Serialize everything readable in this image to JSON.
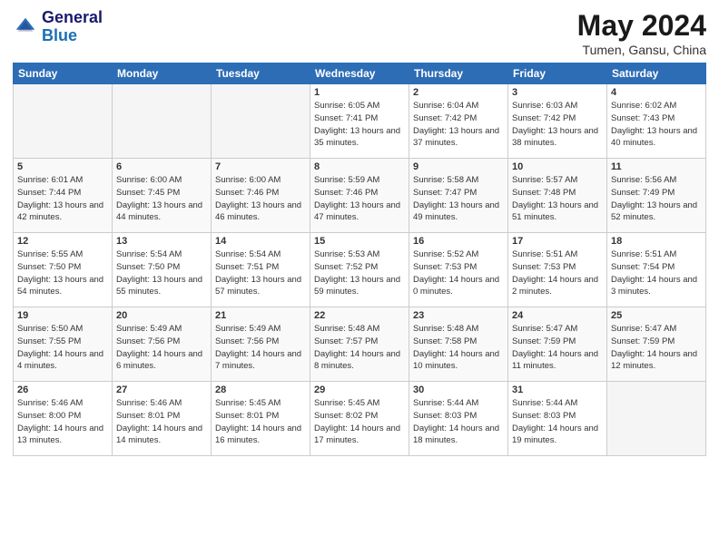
{
  "logo": {
    "line1": "General",
    "line2": "Blue"
  },
  "title": "May 2024",
  "subtitle": "Tumen, Gansu, China",
  "weekdays": [
    "Sunday",
    "Monday",
    "Tuesday",
    "Wednesday",
    "Thursday",
    "Friday",
    "Saturday"
  ],
  "weeks": [
    [
      {
        "day": "",
        "empty": true
      },
      {
        "day": "",
        "empty": true
      },
      {
        "day": "",
        "empty": true
      },
      {
        "day": "1",
        "sunrise": "6:05 AM",
        "sunset": "7:41 PM",
        "daylight": "13 hours and 35 minutes."
      },
      {
        "day": "2",
        "sunrise": "6:04 AM",
        "sunset": "7:42 PM",
        "daylight": "13 hours and 37 minutes."
      },
      {
        "day": "3",
        "sunrise": "6:03 AM",
        "sunset": "7:42 PM",
        "daylight": "13 hours and 38 minutes."
      },
      {
        "day": "4",
        "sunrise": "6:02 AM",
        "sunset": "7:43 PM",
        "daylight": "13 hours and 40 minutes."
      }
    ],
    [
      {
        "day": "5",
        "sunrise": "6:01 AM",
        "sunset": "7:44 PM",
        "daylight": "13 hours and 42 minutes."
      },
      {
        "day": "6",
        "sunrise": "6:00 AM",
        "sunset": "7:45 PM",
        "daylight": "13 hours and 44 minutes."
      },
      {
        "day": "7",
        "sunrise": "6:00 AM",
        "sunset": "7:46 PM",
        "daylight": "13 hours and 46 minutes."
      },
      {
        "day": "8",
        "sunrise": "5:59 AM",
        "sunset": "7:46 PM",
        "daylight": "13 hours and 47 minutes."
      },
      {
        "day": "9",
        "sunrise": "5:58 AM",
        "sunset": "7:47 PM",
        "daylight": "13 hours and 49 minutes."
      },
      {
        "day": "10",
        "sunrise": "5:57 AM",
        "sunset": "7:48 PM",
        "daylight": "13 hours and 51 minutes."
      },
      {
        "day": "11",
        "sunrise": "5:56 AM",
        "sunset": "7:49 PM",
        "daylight": "13 hours and 52 minutes."
      }
    ],
    [
      {
        "day": "12",
        "sunrise": "5:55 AM",
        "sunset": "7:50 PM",
        "daylight": "13 hours and 54 minutes."
      },
      {
        "day": "13",
        "sunrise": "5:54 AM",
        "sunset": "7:50 PM",
        "daylight": "13 hours and 55 minutes."
      },
      {
        "day": "14",
        "sunrise": "5:54 AM",
        "sunset": "7:51 PM",
        "daylight": "13 hours and 57 minutes."
      },
      {
        "day": "15",
        "sunrise": "5:53 AM",
        "sunset": "7:52 PM",
        "daylight": "13 hours and 59 minutes."
      },
      {
        "day": "16",
        "sunrise": "5:52 AM",
        "sunset": "7:53 PM",
        "daylight": "14 hours and 0 minutes."
      },
      {
        "day": "17",
        "sunrise": "5:51 AM",
        "sunset": "7:53 PM",
        "daylight": "14 hours and 2 minutes."
      },
      {
        "day": "18",
        "sunrise": "5:51 AM",
        "sunset": "7:54 PM",
        "daylight": "14 hours and 3 minutes."
      }
    ],
    [
      {
        "day": "19",
        "sunrise": "5:50 AM",
        "sunset": "7:55 PM",
        "daylight": "14 hours and 4 minutes."
      },
      {
        "day": "20",
        "sunrise": "5:49 AM",
        "sunset": "7:56 PM",
        "daylight": "14 hours and 6 minutes."
      },
      {
        "day": "21",
        "sunrise": "5:49 AM",
        "sunset": "7:56 PM",
        "daylight": "14 hours and 7 minutes."
      },
      {
        "day": "22",
        "sunrise": "5:48 AM",
        "sunset": "7:57 PM",
        "daylight": "14 hours and 8 minutes."
      },
      {
        "day": "23",
        "sunrise": "5:48 AM",
        "sunset": "7:58 PM",
        "daylight": "14 hours and 10 minutes."
      },
      {
        "day": "24",
        "sunrise": "5:47 AM",
        "sunset": "7:59 PM",
        "daylight": "14 hours and 11 minutes."
      },
      {
        "day": "25",
        "sunrise": "5:47 AM",
        "sunset": "7:59 PM",
        "daylight": "14 hours and 12 minutes."
      }
    ],
    [
      {
        "day": "26",
        "sunrise": "5:46 AM",
        "sunset": "8:00 PM",
        "daylight": "14 hours and 13 minutes."
      },
      {
        "day": "27",
        "sunrise": "5:46 AM",
        "sunset": "8:01 PM",
        "daylight": "14 hours and 14 minutes."
      },
      {
        "day": "28",
        "sunrise": "5:45 AM",
        "sunset": "8:01 PM",
        "daylight": "14 hours and 16 minutes."
      },
      {
        "day": "29",
        "sunrise": "5:45 AM",
        "sunset": "8:02 PM",
        "daylight": "14 hours and 17 minutes."
      },
      {
        "day": "30",
        "sunrise": "5:44 AM",
        "sunset": "8:03 PM",
        "daylight": "14 hours and 18 minutes."
      },
      {
        "day": "31",
        "sunrise": "5:44 AM",
        "sunset": "8:03 PM",
        "daylight": "14 hours and 19 minutes."
      },
      {
        "day": "",
        "empty": true
      }
    ]
  ]
}
